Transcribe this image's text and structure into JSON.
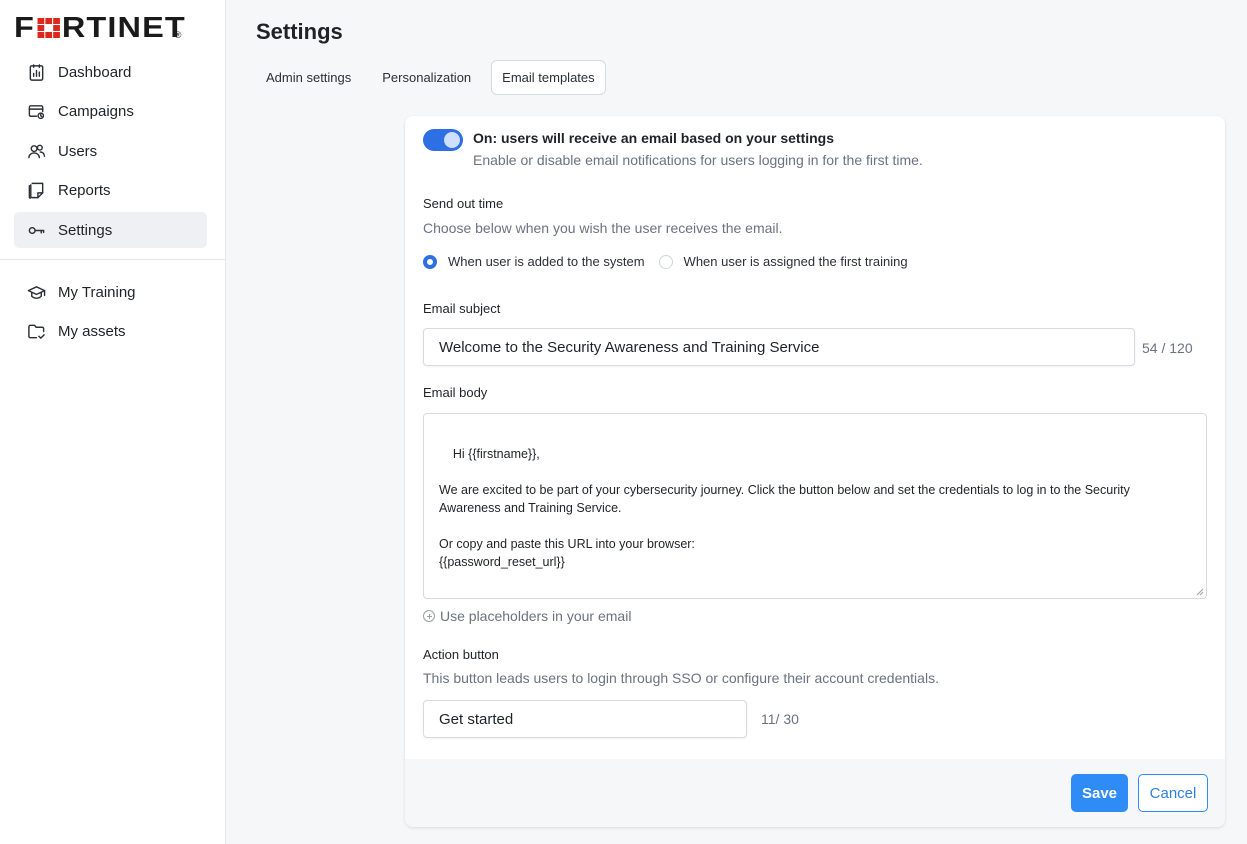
{
  "brand": {
    "logo_prefix": "F",
    "logo_suffix": "RTINET",
    "registered_mark": "®",
    "primary_color": "#2f6fe4",
    "logo_red": "#da291c"
  },
  "sidebar": {
    "items": [
      {
        "label": "Dashboard",
        "icon": "dashboard-icon"
      },
      {
        "label": "Campaigns",
        "icon": "campaigns-icon"
      },
      {
        "label": "Users",
        "icon": "users-icon"
      },
      {
        "label": "Reports",
        "icon": "reports-icon"
      },
      {
        "label": "Settings",
        "icon": "key-icon",
        "active": true
      }
    ],
    "secondary_items": [
      {
        "label": "My Training",
        "icon": "graduation-cap-icon"
      },
      {
        "label": "My assets",
        "icon": "folder-check-icon"
      }
    ]
  },
  "header": {
    "title": "Settings"
  },
  "tabs": [
    {
      "label": "Admin settings",
      "active": false
    },
    {
      "label": "Personalization",
      "active": false
    },
    {
      "label": "Email templates",
      "active": true
    }
  ],
  "email_settings": {
    "toggle_on": true,
    "toggle_title": "On: users will receive an email based on your settings",
    "toggle_description": "Enable or disable email notifications for users logging in for the first time.",
    "send_out_time": {
      "label": "Send out time",
      "description": "Choose below when you wish the user receives the email.",
      "options": [
        {
          "label": "When user is added to the system",
          "selected": true
        },
        {
          "label": "When user is assigned the first training",
          "selected": false
        }
      ]
    },
    "subject": {
      "label": "Email subject",
      "value": "Welcome to the Security Awareness and Training Service",
      "counter": "54 / 120"
    },
    "body": {
      "label": "Email body",
      "value": "Hi {{firstname}},\n\nWe are excited to be part of your cybersecurity journey. Click the button below and set the credentials to log in to the Security Awareness and Training Service.\n\nOr copy and paste this URL into your browser:\n{{password_reset_url}}"
    },
    "placeholders_link": "Use placeholders in your email",
    "action_button": {
      "label": "Action button",
      "description": "This button leads users to login through SSO or configure their account credentials.",
      "value": "Get started",
      "counter": "11/ 30"
    }
  },
  "footer": {
    "save_label": "Save",
    "cancel_label": "Cancel"
  }
}
